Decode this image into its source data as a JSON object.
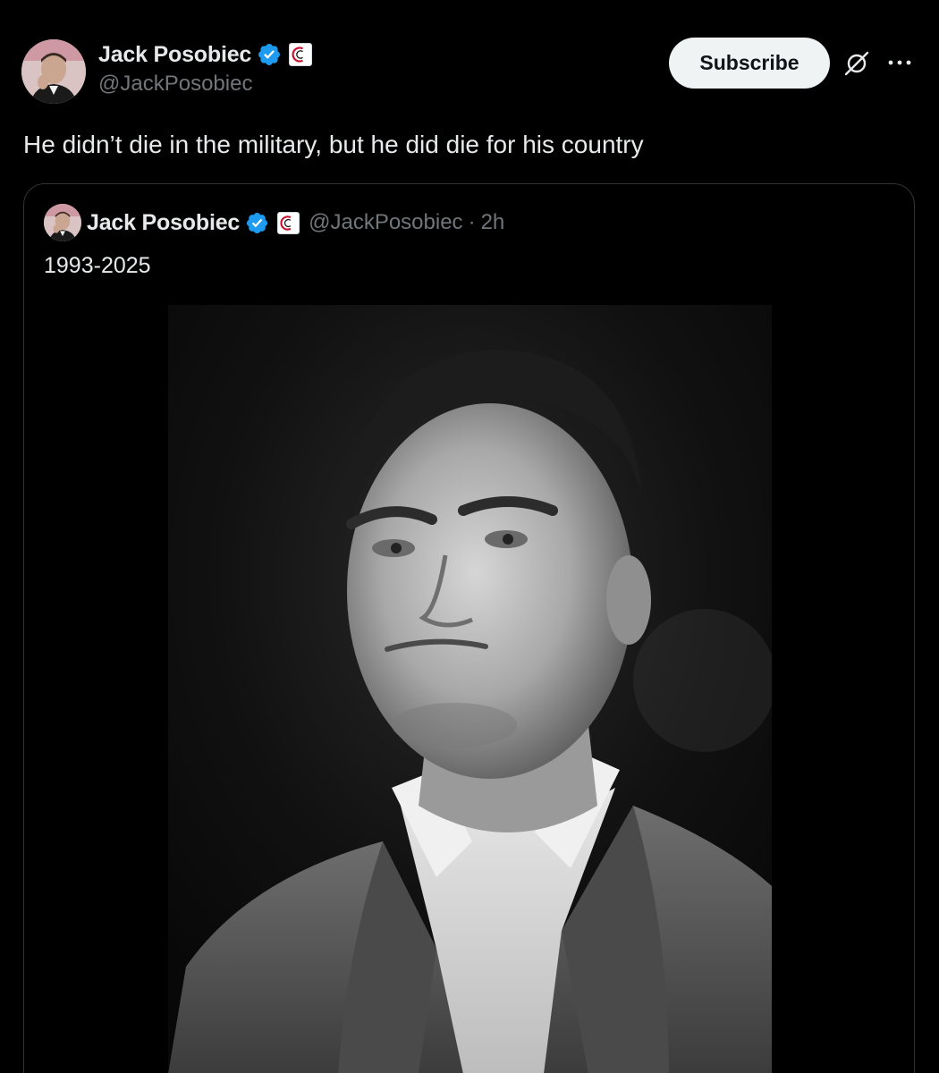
{
  "post": {
    "author": {
      "display_name": "Jack Posobiec",
      "handle": "@JackPosobiec",
      "verified_icon": "verified-badge-icon",
      "affiliation_icon": "affiliation-badge-icon"
    },
    "subscribe_label": "Subscribe",
    "grok_icon": "grok-icon",
    "more_icon": "more-options-icon",
    "text": "He didn’t die in the military, but he did die for his country"
  },
  "quote": {
    "author": {
      "display_name": "Jack Posobiec",
      "handle": "@JackPosobiec",
      "separator": "·",
      "time": "2h"
    },
    "text": "1993-2025",
    "media": {
      "kind": "black-and-white portrait photo"
    }
  },
  "colors": {
    "background": "#000000",
    "text_primary": "#e7e9ea",
    "text_secondary": "#71767b",
    "verified_blue": "#1d9bf0",
    "border": "#2f3336",
    "button_bg": "#eff3f4"
  }
}
